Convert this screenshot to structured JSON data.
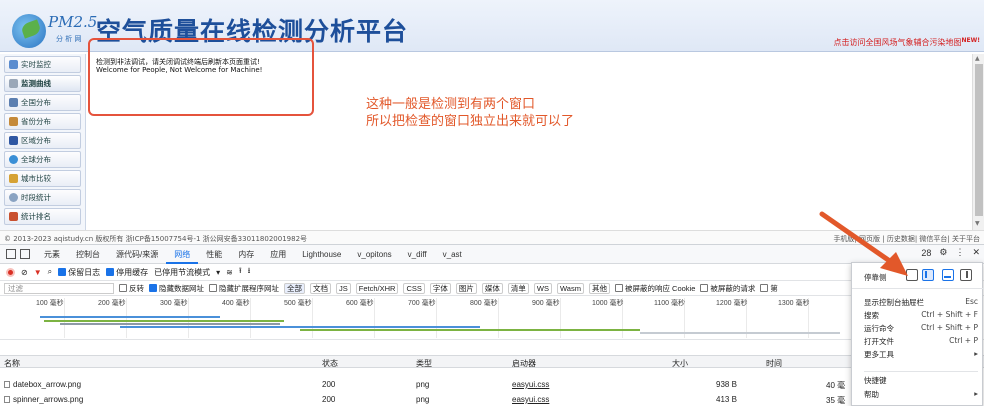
{
  "header": {
    "logo_pm": "PM2.5",
    "logo_sub": "分 析 网",
    "site_title": "空气质量在线检测分析平台",
    "promo_link": "点击访问全国风场气象辅合污染地图",
    "promo_badge": "NEW!"
  },
  "sidebar": {
    "items": [
      {
        "label": "实时监控",
        "icon": "monitor-icon"
      },
      {
        "label": "监测曲线",
        "icon": "chart-icon"
      },
      {
        "label": "全国分布",
        "icon": "map-icon"
      },
      {
        "label": "省份分布",
        "icon": "province-icon"
      },
      {
        "label": "区域分布",
        "icon": "region-icon"
      },
      {
        "label": "全球分布",
        "icon": "globe-icon"
      },
      {
        "label": "城市比较",
        "icon": "compare-icon"
      },
      {
        "label": "时段统计",
        "icon": "clock-icon"
      },
      {
        "label": "统计排名",
        "icon": "rank-icon"
      }
    ]
  },
  "content": {
    "message_line1": "检测到非法调试，请关闭调试终端后刷新本页面重试!",
    "message_line2": "Welcome for People, Not Welcome for Machine!",
    "annotation_line1": "这种一般是检测到有两个窗口",
    "annotation_line2": "所以把检查的窗口独立出来就可以了"
  },
  "footer": {
    "left": "© 2013-2023 aqistudy.cn 版权所有 浙ICP备15007754号-1 浙公网安备33011802001982号",
    "right": "手机版| 网页版 | 历史数据| 微信平台| 关于平台"
  },
  "devtools": {
    "tabs": [
      "元素",
      "控制台",
      "源代码/来源",
      "网络",
      "性能",
      "内存",
      "应用",
      "Lighthouse",
      "v_opitons",
      "v_diff",
      "v_ast"
    ],
    "badge_count": "28",
    "toolbar": {
      "preserve_log": "保留日志",
      "disable_cache": "停用缓存",
      "throttle": "已停用节流模式"
    },
    "filter": {
      "placeholder": "过滤",
      "invert": "反转",
      "hide_data_urls": "隐藏数据网址",
      "hide_ext_urls": "隐藏扩展程序网址",
      "types": [
        "全部",
        "文档",
        "JS",
        "Fetch/XHR",
        "CSS",
        "字体",
        "图片",
        "媒体",
        "清单",
        "WS",
        "Wasm",
        "其他"
      ],
      "blocked_cookies": "被屏蔽的响应 Cookie",
      "blocked_requests": "被屏蔽的请求",
      "third_party": "第"
    },
    "timeline_ticks": [
      "100 毫秒",
      "200 毫秒",
      "300 毫秒",
      "400 毫秒",
      "500 毫秒",
      "600 毫秒",
      "700 毫秒",
      "800 毫秒",
      "900 毫秒",
      "1000 毫秒",
      "1100 毫秒",
      "1200 毫秒",
      "1300 毫秒"
    ],
    "table": {
      "headers": [
        "名称",
        "状态",
        "类型",
        "启动器",
        "大小",
        "时间"
      ],
      "rows": [
        {
          "name": "datebox_arrow.png",
          "status": "200",
          "type": "png",
          "initiator": "easyui.css",
          "size": "938 B",
          "time": "40 毫"
        },
        {
          "name": "spinner_arrows.png",
          "status": "200",
          "type": "png",
          "initiator": "easyui.css",
          "size": "413 B",
          "time": "35 毫"
        }
      ]
    }
  },
  "context_menu": {
    "dock_label": "停靠侧",
    "items": [
      {
        "label": "显示控制台抽屉栏",
        "shortcut": "Esc"
      },
      {
        "label": "搜索",
        "shortcut": "Ctrl + Shift + F"
      },
      {
        "label": "运行命令",
        "shortcut": "Ctrl + Shift + P"
      },
      {
        "label": "打开文件",
        "shortcut": "Ctrl + P"
      },
      {
        "label": "更多工具",
        "shortcut": "▸"
      },
      {
        "label": "快捷键",
        "shortcut": ""
      },
      {
        "label": "帮助",
        "shortcut": "▸"
      }
    ]
  },
  "colors": {
    "accent": "#1a73e8",
    "annotation": "#e2582a",
    "title": "#1e4f9a"
  }
}
